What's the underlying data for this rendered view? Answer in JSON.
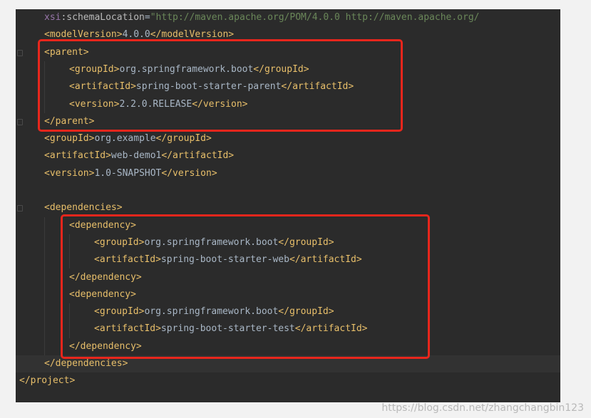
{
  "lines": [
    {
      "indent": 1,
      "parts": [
        [
          "attr-ns",
          "xsi"
        ],
        [
          "attr",
          ":schemaLocation"
        ],
        [
          "txt",
          "="
        ],
        [
          "str",
          "\"http://maven.apache.org/POM/4.0.0 http://maven.apache.org/"
        ]
      ]
    },
    {
      "indent": 1,
      "parts": [
        [
          "tag",
          "<modelVersion>"
        ],
        [
          "txt",
          "4.0.0"
        ],
        [
          "tag",
          "</modelVersion>"
        ]
      ]
    },
    {
      "indent": 1,
      "parts": [
        [
          "tag",
          "<parent>"
        ]
      ]
    },
    {
      "indent": 2,
      "parts": [
        [
          "tag",
          "<groupId>"
        ],
        [
          "txt",
          "org.springframework.boot"
        ],
        [
          "tag",
          "</groupId>"
        ]
      ]
    },
    {
      "indent": 2,
      "parts": [
        [
          "tag",
          "<artifactId>"
        ],
        [
          "txt",
          "spring-boot-starter-parent"
        ],
        [
          "tag",
          "</artifactId>"
        ]
      ]
    },
    {
      "indent": 2,
      "parts": [
        [
          "tag",
          "<version>"
        ],
        [
          "txt",
          "2.2.0.RELEASE"
        ],
        [
          "tag",
          "</version>"
        ]
      ]
    },
    {
      "indent": 1,
      "parts": [
        [
          "tag",
          "</parent>"
        ]
      ]
    },
    {
      "indent": 1,
      "parts": [
        [
          "tag",
          "<groupId>"
        ],
        [
          "txt",
          "org.example"
        ],
        [
          "tag",
          "</groupId>"
        ]
      ]
    },
    {
      "indent": 1,
      "parts": [
        [
          "tag",
          "<artifactId>"
        ],
        [
          "txt",
          "web-demo1"
        ],
        [
          "tag",
          "</artifactId>"
        ]
      ]
    },
    {
      "indent": 1,
      "parts": [
        [
          "tag",
          "<version>"
        ],
        [
          "txt",
          "1.0-SNAPSHOT"
        ],
        [
          "tag",
          "</version>"
        ]
      ]
    },
    {
      "indent": 1,
      "parts": []
    },
    {
      "indent": 1,
      "parts": [
        [
          "tag",
          "<dependencies>"
        ]
      ]
    },
    {
      "indent": 2,
      "parts": [
        [
          "tag",
          "<dependency>"
        ]
      ]
    },
    {
      "indent": 3,
      "parts": [
        [
          "tag",
          "<groupId>"
        ],
        [
          "txt",
          "org.springframework.boot"
        ],
        [
          "tag",
          "</groupId>"
        ]
      ]
    },
    {
      "indent": 3,
      "parts": [
        [
          "tag",
          "<artifactId>"
        ],
        [
          "txt",
          "spring-boot-starter-web"
        ],
        [
          "tag",
          "</artifactId>"
        ]
      ]
    },
    {
      "indent": 2,
      "parts": [
        [
          "tag",
          "</dependency>"
        ]
      ]
    },
    {
      "indent": 2,
      "parts": [
        [
          "tag",
          "<dependency>"
        ]
      ]
    },
    {
      "indent": 3,
      "parts": [
        [
          "tag",
          "<groupId>"
        ],
        [
          "txt",
          "org.springframework.boot"
        ],
        [
          "tag",
          "</groupId>"
        ]
      ]
    },
    {
      "indent": 3,
      "parts": [
        [
          "tag",
          "<artifactId>"
        ],
        [
          "txt",
          "spring-boot-starter-test"
        ],
        [
          "tag",
          "</artifactId>"
        ]
      ]
    },
    {
      "indent": 2,
      "parts": [
        [
          "tag",
          "</dependency>"
        ]
      ]
    },
    {
      "indent": 1,
      "parts": [
        [
          "tag",
          "</dependencies>"
        ]
      ]
    },
    {
      "indent": 0,
      "parts": [
        [
          "tag",
          "</project>"
        ]
      ]
    }
  ],
  "current_line": 20,
  "fold_lines": [
    2,
    6,
    11,
    20
  ],
  "watermark": "https://blog.csdn.net/zhangchangbin123",
  "colors": {
    "editor_bg": "#2b2b2b",
    "tag": "#e8bf6a",
    "text": "#a9b7c6",
    "string": "#6a8759",
    "highlight_box": "#e8261c"
  }
}
